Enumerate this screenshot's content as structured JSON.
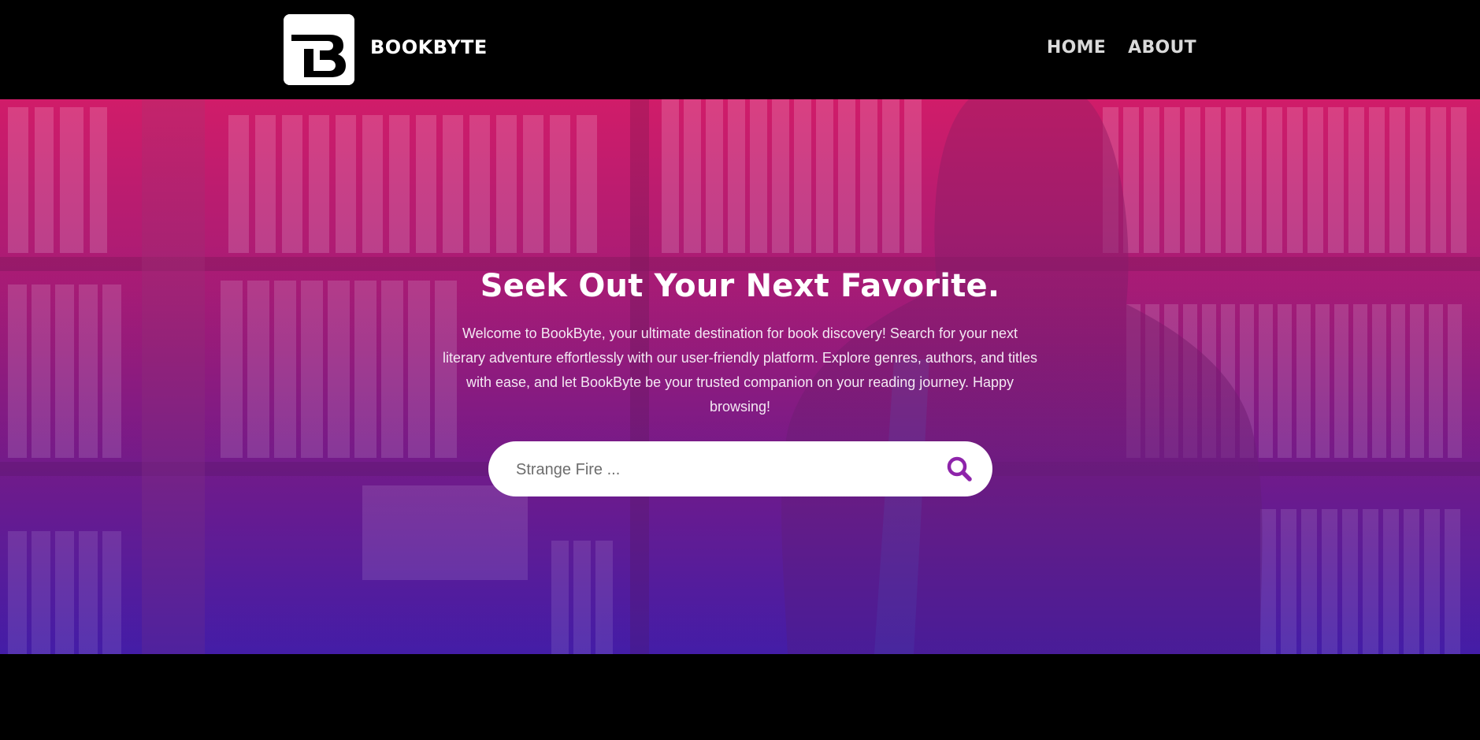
{
  "brand": {
    "name": "BOOKBYTE",
    "logo_icon": "bookbyte-logo"
  },
  "nav": {
    "items": [
      {
        "label": "HOME"
      },
      {
        "label": "ABOUT"
      }
    ]
  },
  "hero": {
    "title": "Seek Out Your Next Favorite.",
    "description": "Welcome to BookByte, your ultimate destination for book discovery! Search for your next literary adventure effortlessly with our user-friendly platform. Explore genres, authors, and titles with ease, and let BookByte be your trusted companion on your reading journey. Happy browsing!"
  },
  "search": {
    "placeholder": "Strange Fire ...",
    "icon": "search-icon",
    "accent_color": "#8e24aa"
  },
  "colors": {
    "header_bg": "#000000",
    "hero_gradient_top": "#c21a63",
    "hero_gradient_bottom": "#3f1ba0"
  }
}
